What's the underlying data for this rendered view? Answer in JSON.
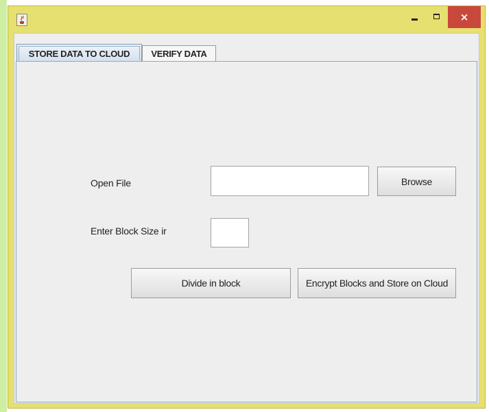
{
  "window": {
    "title": "",
    "icon": "java-cup-icon",
    "controls": {
      "minimize": "minimize-icon",
      "maximize": "maximize-icon",
      "close": "×"
    }
  },
  "tabs": [
    {
      "label": "STORE DATA TO CLOUD",
      "selected": true
    },
    {
      "label": "VERIFY DATA",
      "selected": false
    }
  ],
  "form": {
    "open_file_label": "Open File",
    "file_path_value": "",
    "browse_label": "Browse",
    "block_size_label": "Enter Block Size ir",
    "block_size_value": "",
    "divide_label": "Divide in block",
    "encrypt_label": "Encrypt Blocks and Store on Cloud"
  },
  "colors": {
    "window_frame": "#e6e070",
    "close_button": "#c9483c",
    "tab_border": "#7c9ab8",
    "panel_bg": "#eeeeee"
  }
}
